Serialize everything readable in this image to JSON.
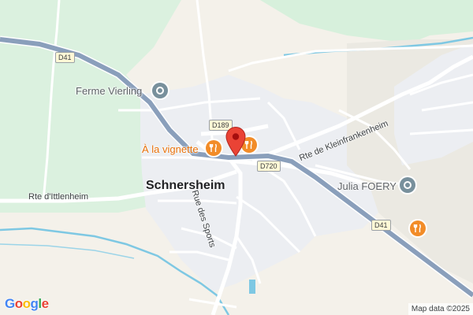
{
  "map": {
    "town": "Schnersheim",
    "pois": {
      "ferme": "Ferme Vierling",
      "vignette": "À la vignette",
      "julia": "Julia FOERY"
    },
    "roads": {
      "rte_kleinfrankenheim": "Rte de Kleinfrankenheim",
      "rte_ittlenheim": "Rte d'Ittlenheim",
      "rue_sports": "Rue des Sports"
    },
    "route_shields": {
      "d41_a": "D41",
      "d189": "D189",
      "d720": "D720",
      "d41_b": "D41"
    },
    "attribution": "Map data ©2025",
    "logo": {
      "letters": [
        "G",
        "o",
        "o",
        "g",
        "l",
        "e"
      ],
      "colors": [
        "#4285f4",
        "#ea4335",
        "#fbbc05",
        "#4285f4",
        "#34a853",
        "#ea4335"
      ]
    },
    "colors": {
      "land": "#f4f1ea",
      "green": "#d7f0dc",
      "urban": "#eceef2",
      "water": "#7ec8e3",
      "main_road": "#8a9fbb",
      "pin": "#ea4335"
    },
    "icons": {
      "landmark": "landmark-icon",
      "restaurant": "restaurant-icon",
      "pin": "location-pin-icon"
    }
  }
}
